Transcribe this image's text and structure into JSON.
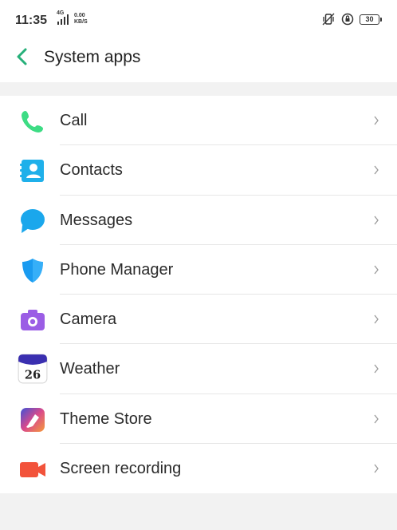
{
  "status_bar": {
    "time": "11:35",
    "network": "4G",
    "speed_value": "0.00",
    "speed_unit": "KB/S",
    "battery": "30"
  },
  "header": {
    "title": "System apps",
    "back_icon": "chevron-left-icon"
  },
  "apps": [
    {
      "label": "Call",
      "icon": "phone-icon",
      "color": "#3ddc84"
    },
    {
      "label": "Contacts",
      "icon": "contacts-icon",
      "color": "#1fb0ea"
    },
    {
      "label": "Messages",
      "icon": "message-bubble-icon",
      "color": "#1aa7ec"
    },
    {
      "label": "Phone Manager",
      "icon": "shield-icon",
      "color": "#1a9bf0"
    },
    {
      "label": "Camera",
      "icon": "camera-icon",
      "color": "#9b5de5"
    },
    {
      "label": "Weather",
      "icon": "weather-icon",
      "number": "26"
    },
    {
      "label": "Theme Store",
      "icon": "theme-store-icon",
      "color": "#ef5a6f"
    },
    {
      "label": "Screen recording",
      "icon": "screen-recording-icon",
      "color": "#f2533b"
    }
  ]
}
